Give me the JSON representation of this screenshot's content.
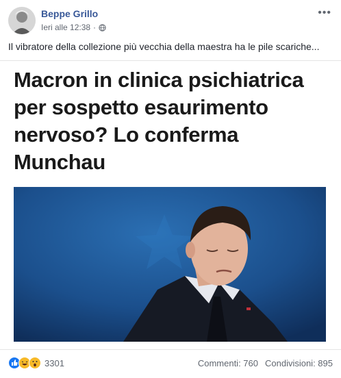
{
  "post": {
    "author": "Beppe Grillo",
    "time": "Ieri alle 12:38",
    "privacy_icon": "globe-icon",
    "more_icon": "more-options-icon",
    "text": "Il vibratore della collezione più vecchia della maestra ha le pile scariche..."
  },
  "card": {
    "headline": "Macron in clinica psichiatrica per sospetto esaurimento nervoso? Lo conferma Munchau"
  },
  "footer": {
    "reaction_icons": [
      "like-icon",
      "haha-icon",
      "wow-icon"
    ],
    "reaction_count": "3301",
    "comments": "Commenti: 760",
    "shares": "Condivisioni: 895"
  },
  "colors": {
    "link": "#385898",
    "meta": "#616770",
    "like": "#1877f2",
    "emoji": "#f7b928"
  }
}
